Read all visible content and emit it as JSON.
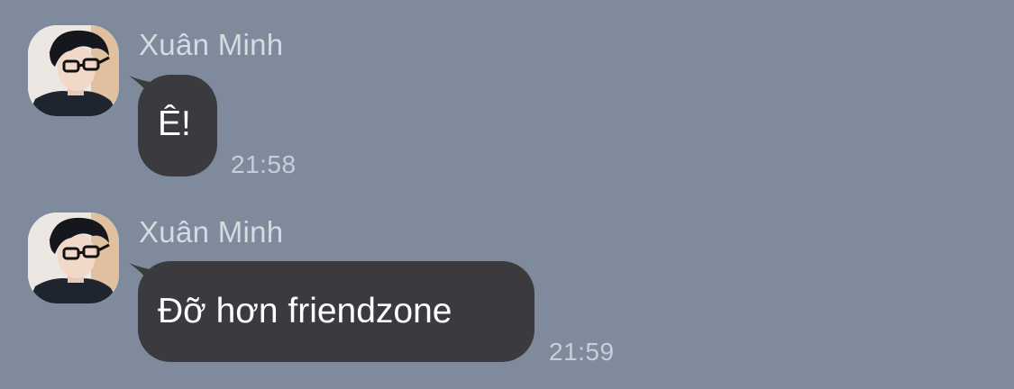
{
  "chat": {
    "messages": [
      {
        "sender": "Xuân Minh",
        "text": "Ê!",
        "time": "21:58",
        "avatar_icon": "profile-photo"
      },
      {
        "sender": "Xuân Minh",
        "text": "Đỡ hơn friendzone",
        "time": "21:59",
        "avatar_icon": "profile-photo"
      }
    ],
    "colors": {
      "background": "#7f8a9c",
      "bubble": "#3b3b3f",
      "bubble_text": "#ffffff",
      "sender_name": "#d6dae1",
      "timestamp": "#c9ced7"
    }
  }
}
